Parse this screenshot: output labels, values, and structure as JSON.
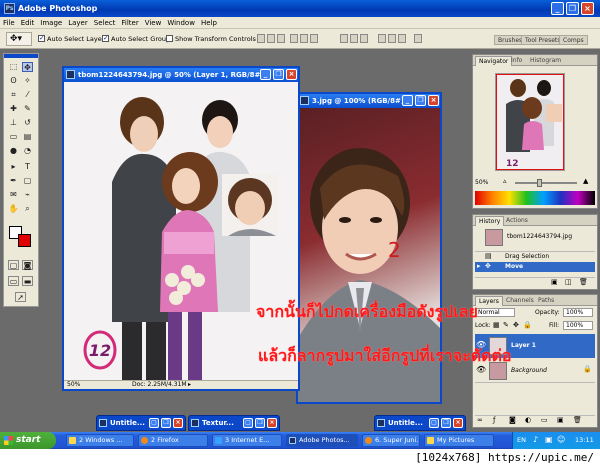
{
  "app": {
    "title": "Adobe Photoshop"
  },
  "menu": [
    "File",
    "Edit",
    "Image",
    "Layer",
    "Select",
    "Filter",
    "View",
    "Window",
    "Help"
  ],
  "options": {
    "auto_select_layer": "Auto Select Layer",
    "auto_select_groups": "Auto Select Groups",
    "show_transform_controls": "Show Transform Controls"
  },
  "palette_well": [
    "Brushes",
    "Tool Presets",
    "Comps"
  ],
  "doc1": {
    "title": "tbom1224643794.jpg @ 50% (Layer 1, RGB/8#)",
    "zoom": "50%",
    "docsize": "Doc: 2.25M/4.31M"
  },
  "doc2": {
    "title": "3.jpg @ 100% (RGB/8#)",
    "number_mark": "2"
  },
  "navigator": {
    "tabs": [
      "Navigator",
      "Info",
      "Histogram"
    ],
    "zoom": "50%"
  },
  "history": {
    "tabs": [
      "History",
      "Actions"
    ],
    "snapshot": "tbom1224643794.jpg",
    "items": [
      "Drag Selection",
      "Move"
    ]
  },
  "layers": {
    "tabs": [
      "Layers",
      "Channels",
      "Paths"
    ],
    "mode": "Normal",
    "opacity_label": "Opacity:",
    "opacity": "100%",
    "lock_label": "Lock:",
    "fill_label": "Fill:",
    "fill": "100%",
    "items": [
      "Layer 1",
      "Background"
    ]
  },
  "minimized": [
    "Untitle...",
    "Textur...",
    "Untitle..."
  ],
  "taskbar": {
    "start": "start",
    "tasks": [
      "2 Windows ...",
      "2 Firefox",
      "3 Internet E...",
      "Adobe Photos...",
      "6. Super Juni...",
      "My Pictures"
    ],
    "lang": "EN",
    "clock": "13:11"
  },
  "caption": {
    "line1": "จากนั้นก็ไปกดเครื่องมือดังรูปเลย",
    "line2": "แล้วก็ลากรูปมาใส่อีกรูปที่เราจะตัดต่อ"
  },
  "footer": {
    "watermark": "[1024x768] https://upic.me/"
  },
  "colors": {
    "xp_blue": "#0a48c9",
    "caption_red": "#ff1a1a",
    "panel_bg": "#ece9d8",
    "workspace": "#6b6b6b"
  }
}
